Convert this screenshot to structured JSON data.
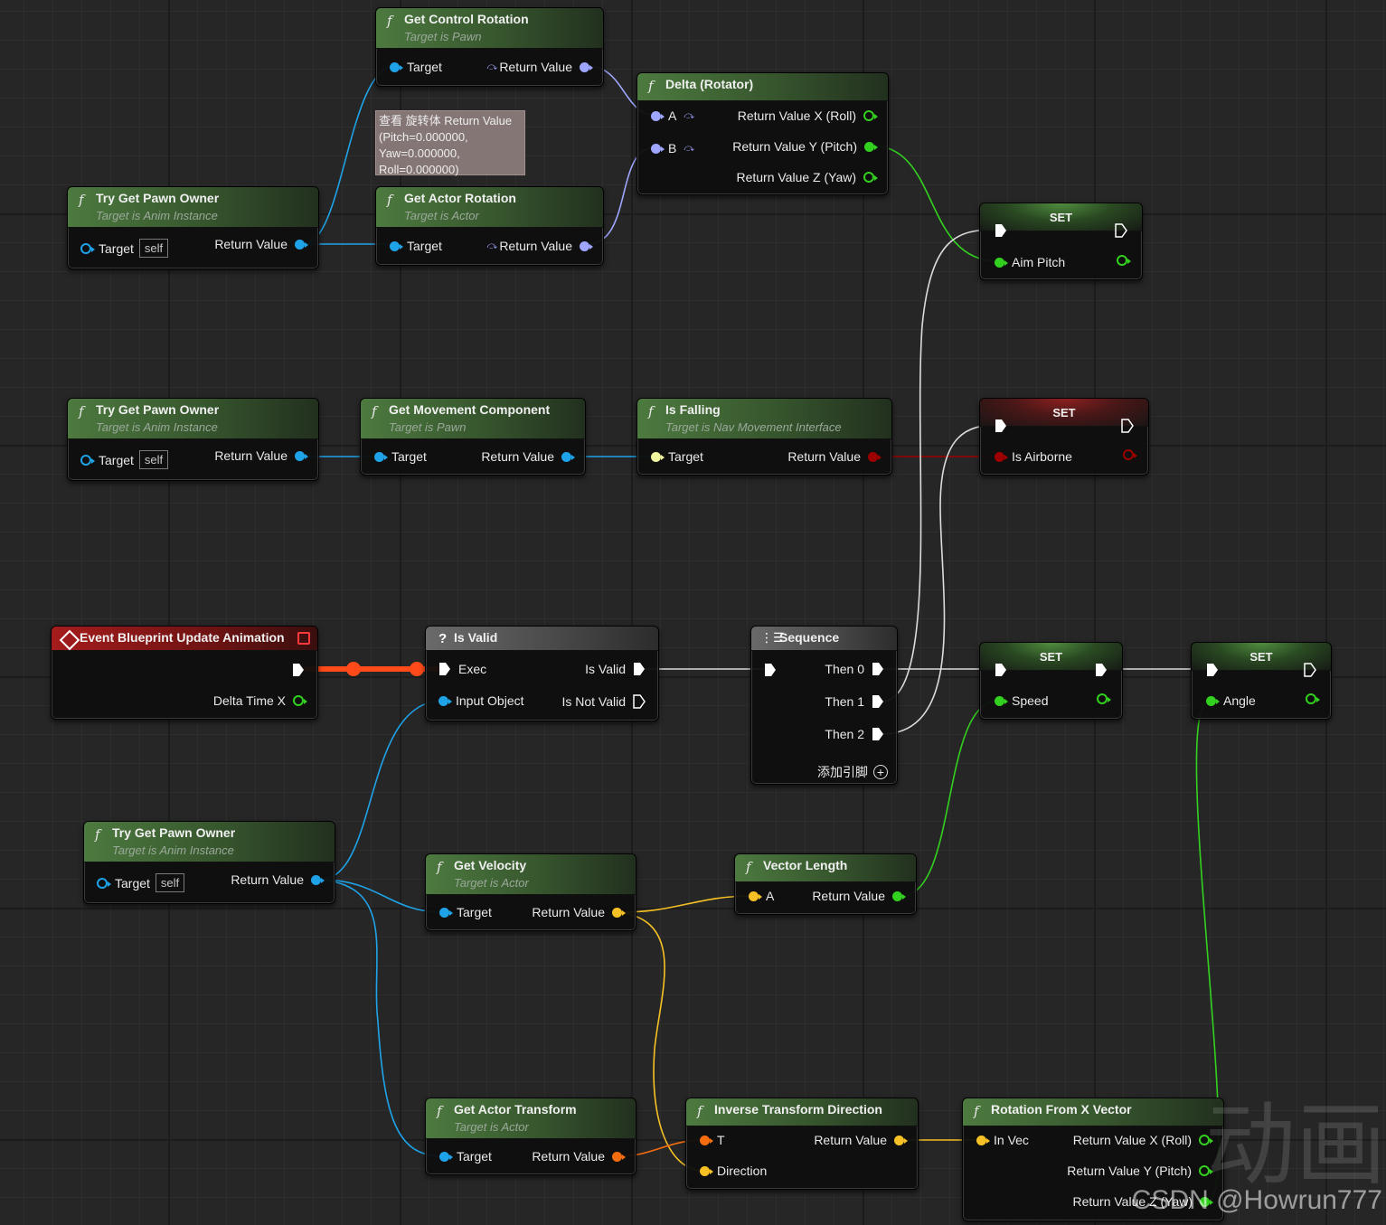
{
  "nodes": {
    "get_control_rotation": {
      "title": "Get Control Rotation",
      "subtitle": "Target is Pawn",
      "in": "Target",
      "out": "Return Value"
    },
    "delta_rotator": {
      "title": "Delta (Rotator)",
      "a": "A",
      "b": "B",
      "out_x": "Return Value X (Roll)",
      "out_y": "Return Value Y (Pitch)",
      "out_z": "Return Value Z (Yaw)"
    },
    "tooltip": {
      "line1": "查看 旋转体 Return Value",
      "line2": "(Pitch=0.000000,",
      "line3": "Yaw=0.000000,",
      "line4": "Roll=0.000000)"
    },
    "try_get_pawn_owner_1": {
      "title": "Try Get Pawn Owner",
      "subtitle": "Target is Anim Instance",
      "in": "Target",
      "self": "self",
      "out": "Return Value"
    },
    "get_actor_rotation": {
      "title": "Get Actor Rotation",
      "subtitle": "Target is Actor",
      "in": "Target",
      "out": "Return Value"
    },
    "set_aim_pitch": {
      "title": "SET",
      "var": "Aim Pitch"
    },
    "try_get_pawn_owner_2": {
      "title": "Try Get Pawn Owner",
      "subtitle": "Target is Anim Instance",
      "in": "Target",
      "self": "self",
      "out": "Return Value"
    },
    "get_movement_component": {
      "title": "Get Movement Component",
      "subtitle": "Target is Pawn",
      "in": "Target",
      "out": "Return Value"
    },
    "is_falling": {
      "title": "Is Falling",
      "subtitle": "Target is Nav Movement Interface",
      "in": "Target",
      "out": "Return Value"
    },
    "set_is_airborne": {
      "title": "SET",
      "var": "Is Airborne"
    },
    "event_update": {
      "title": "Event Blueprint Update Animation",
      "out": "Delta Time X"
    },
    "is_valid": {
      "title": "Is Valid",
      "exec": "Exec",
      "input": "Input Object",
      "valid": "Is Valid",
      "not_valid": "Is Not Valid"
    },
    "sequence": {
      "title": "Sequence",
      "then0": "Then 0",
      "then1": "Then 1",
      "then2": "Then 2",
      "add_pin": "添加引脚"
    },
    "set_speed": {
      "title": "SET",
      "var": "Speed"
    },
    "set_angle": {
      "title": "SET",
      "var": "Angle"
    },
    "try_get_pawn_owner_3": {
      "title": "Try Get Pawn Owner",
      "subtitle": "Target is Anim Instance",
      "in": "Target",
      "self": "self",
      "out": "Return Value"
    },
    "get_velocity": {
      "title": "Get Velocity",
      "subtitle": "Target is Actor",
      "in": "Target",
      "out": "Return Value"
    },
    "vector_length": {
      "title": "Vector Length",
      "a": "A",
      "out": "Return Value"
    },
    "get_actor_transform": {
      "title": "Get Actor Transform",
      "subtitle": "Target is Actor",
      "in": "Target",
      "out": "Return Value"
    },
    "inverse_transform_direction": {
      "title": "Inverse Transform Direction",
      "t": "T",
      "direction": "Direction",
      "out": "Return Value"
    },
    "rotation_from_x_vector": {
      "title": "Rotation From X Vector",
      "in": "In Vec",
      "out_x": "Return Value X (Roll)",
      "out_y": "Return Value Y (Pitch)",
      "out_z": "Return Value Z (Yaw)"
    }
  },
  "watermark": "CSDN @Howrun777",
  "watermark_cn": "动画",
  "colors": {
    "object_pin": "#1fa3e8",
    "rotator_pin": "#9fa6ff",
    "float_pin": "#33d11f",
    "bool_pin": "#9c0000",
    "vector_pin": "#f6c124",
    "transform_pin": "#f66d0f",
    "interface_pin": "#f2f5a0",
    "exec_pin": "#ffffff",
    "function_header": "#4d7a3f",
    "event_header": "#a51c1c"
  }
}
